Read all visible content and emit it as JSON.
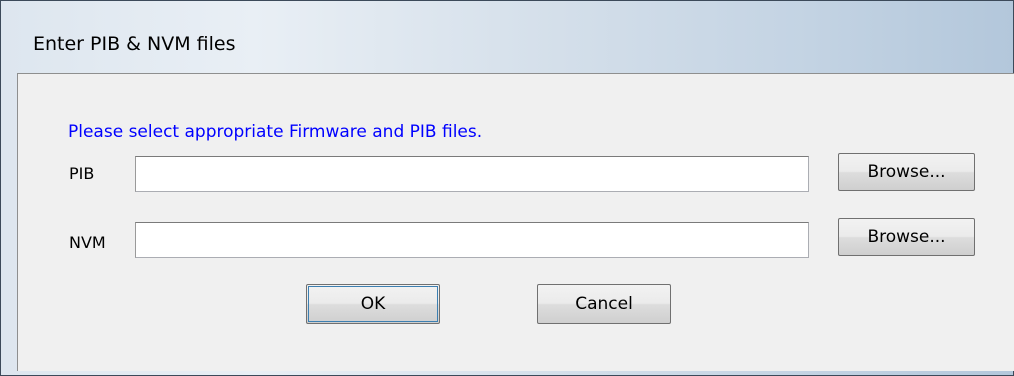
{
  "window": {
    "title": "Enter PIB & NVM files"
  },
  "dialog": {
    "instruction": "Please select appropriate Firmware and PIB files.",
    "pib": {
      "label": "PIB",
      "value": "",
      "browse_label": "Browse..."
    },
    "nvm": {
      "label": "NVM",
      "value": "",
      "browse_label": "Browse..."
    },
    "ok_label": "OK",
    "cancel_label": "Cancel"
  },
  "colors": {
    "instruction_text": "#0000ff",
    "dialog_background": "#f0f0f0"
  }
}
